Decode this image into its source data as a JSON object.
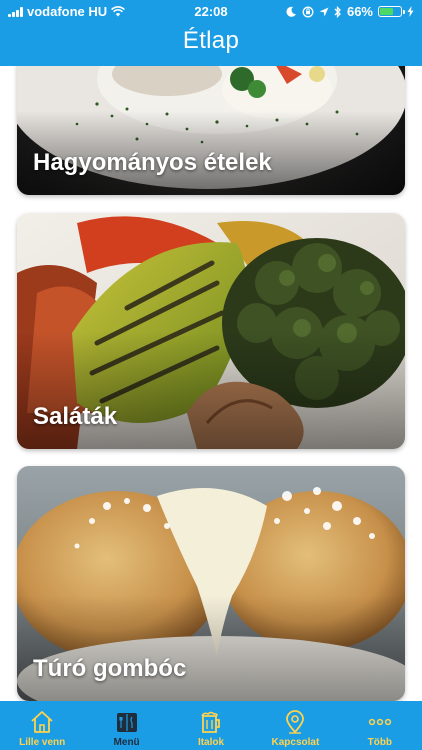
{
  "status_bar": {
    "carrier": "vodafone HU",
    "time": "22:08",
    "battery": "66%",
    "battery_level": 0.66
  },
  "header": {
    "title": "Étlap"
  },
  "categories": [
    {
      "label": "Hagyományos ételek",
      "image": "plated-dish-photo"
    },
    {
      "label": "Saláták",
      "image": "grilled-vegetables-photo"
    },
    {
      "label": "Túró gombóc",
      "image": "cottage-cheese-dumpling-photo"
    }
  ],
  "tabs": [
    {
      "label": "Lille venn",
      "icon": "home-icon",
      "active": false
    },
    {
      "label": "Menü",
      "icon": "menu-book-icon",
      "active": true
    },
    {
      "label": "Italok",
      "icon": "beer-mug-icon",
      "active": false
    },
    {
      "label": "Kapcsolat",
      "icon": "location-pin-icon",
      "active": false
    },
    {
      "label": "Több",
      "icon": "more-dots-icon",
      "active": false
    }
  ],
  "colors": {
    "primary": "#1b9de6",
    "tab_inactive": "#ffd34d",
    "tab_active": "#1f2d3d",
    "battery": "#4cd964"
  }
}
